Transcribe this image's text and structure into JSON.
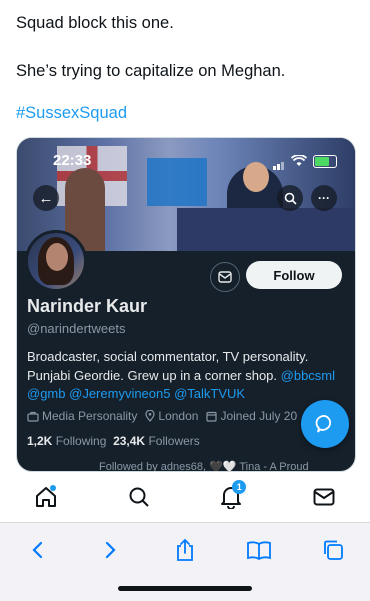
{
  "tweet": {
    "line1": "Squad block this one.",
    "line2": "She’s trying to capitalize on Meghan.",
    "hashtag": "#SussexSquad"
  },
  "embedded": {
    "status_time": "22:33",
    "follow_label": "Follow",
    "name": "Narinder Kaur",
    "handle": "@narindertweets",
    "bio_text": "Broadcaster, social commentator, TV personality. Punjabi Geordie. Grew up in a corner shop. ",
    "bio_links": [
      "@bbcsml",
      "@gmb",
      "@Jeremyvineon5",
      "@TalkTVUK"
    ],
    "meta": {
      "category": "Media Personality",
      "location": "London",
      "joined": "Joined July 20"
    },
    "counts": {
      "following_value": "1,2K",
      "following_label": "Following",
      "followers_value": "23,4K",
      "followers_label": "Followers"
    },
    "followed_by": "Followed by adnes68, 🖤🤍 Tina - A Proud"
  },
  "tabbar": {
    "notification_count": "1"
  },
  "colors": {
    "accent": "#1d9bf0",
    "card_bg": "#15202b"
  }
}
